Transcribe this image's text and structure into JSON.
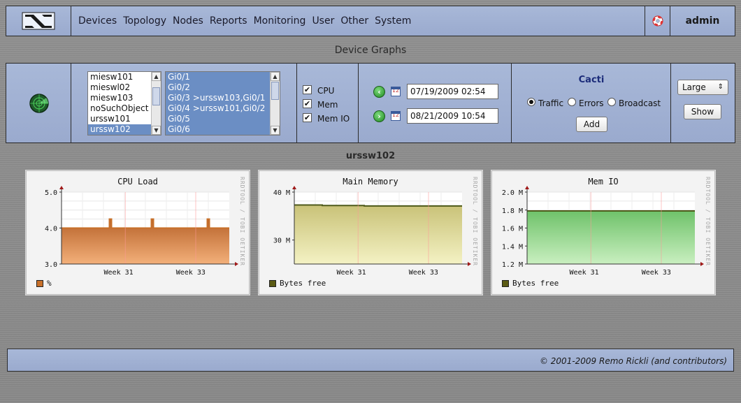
{
  "nav": {
    "menu": [
      "Devices",
      "Topology",
      "Nodes",
      "Reports",
      "Monitoring",
      "User",
      "Other",
      "System"
    ],
    "user": "admin"
  },
  "page_title": "Device Graphs",
  "controls": {
    "devices": [
      "miesw101",
      "mieswl02",
      "miesw103",
      "noSuchObject",
      "urssw101",
      "urssw102"
    ],
    "selected_device": "urssw102",
    "interfaces": [
      "Gi0/1",
      "Gi0/2",
      "Gi0/3 >urssw103,Gi0/1",
      "Gi0/4 >urssw101,Gi0/2",
      "Gi0/5",
      "Gi0/6"
    ],
    "checks": [
      {
        "label": "CPU",
        "checked": true
      },
      {
        "label": "Mem",
        "checked": true
      },
      {
        "label": "Mem IO",
        "checked": true
      }
    ],
    "date_from": "07/19/2009 02:54",
    "date_to": "08/21/2009 10:54",
    "cacti_label": "Cacti",
    "radios": [
      {
        "label": "Traffic",
        "checked": true
      },
      {
        "label": "Errors",
        "checked": false
      },
      {
        "label": "Broadcast",
        "checked": false
      }
    ],
    "add_label": "Add",
    "size_value": "Large",
    "show_label": "Show"
  },
  "device_name": "urssw102",
  "watermark": "RRDTOOL / TOBI OETIKER",
  "footer": "© 2001-2009 Remo Rickli (and contributors)",
  "colors": {
    "cpu": "#c8702a",
    "mem": "#e4e096",
    "memio": "#8fd47a",
    "line": "#4e5a1a"
  },
  "chart_data": [
    {
      "type": "area",
      "title": "CPU Load",
      "x_ticks": [
        "Week 31",
        "Week 33"
      ],
      "y_ticks": [
        "5.0",
        "4.0",
        "3.0"
      ],
      "ylim": [
        3.0,
        5.0
      ],
      "series": [
        {
          "name": "%",
          "values": [
            4.0,
            4.0,
            4.0,
            4.25,
            4.0,
            4.0,
            4.25,
            4.0,
            4.0,
            4.0,
            4.25,
            4.0
          ]
        }
      ]
    },
    {
      "type": "area",
      "title": "Main Memory",
      "x_ticks": [
        "Week 31",
        "Week 33"
      ],
      "y_ticks": [
        "40 M",
        "30 M"
      ],
      "ylim": [
        25,
        40
      ],
      "series": [
        {
          "name": "Bytes free",
          "values": [
            37.3,
            37.3,
            37.2,
            37.2,
            37.2,
            37.1,
            37.1,
            37.1,
            37.1,
            37.1,
            37.1,
            37.1
          ]
        }
      ]
    },
    {
      "type": "area",
      "title": "Mem IO",
      "x_ticks": [
        "Week 31",
        "Week 33"
      ],
      "y_ticks": [
        "2.0 M",
        "1.8 M",
        "1.6 M",
        "1.4 M",
        "1.2 M"
      ],
      "ylim": [
        1.2,
        2.0
      ],
      "series": [
        {
          "name": "Bytes free",
          "values": [
            1.79,
            1.79,
            1.79,
            1.79,
            1.79,
            1.79,
            1.79,
            1.79,
            1.79,
            1.79,
            1.79,
            1.79
          ]
        }
      ]
    }
  ]
}
